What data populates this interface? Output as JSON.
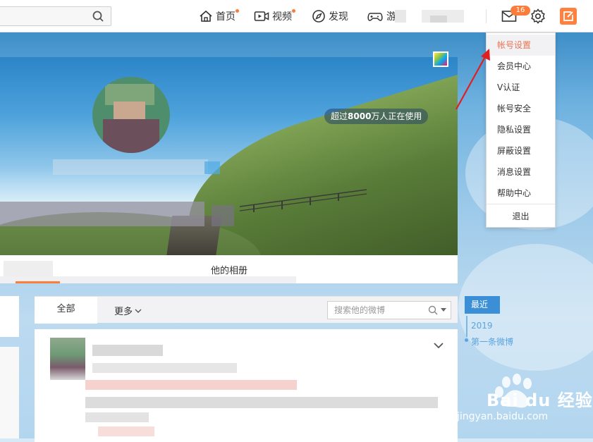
{
  "topbar": {
    "nav": [
      {
        "label": "首页",
        "icon": "home-icon"
      },
      {
        "label": "视频",
        "icon": "video-icon"
      },
      {
        "label": "发现",
        "icon": "compass-icon"
      },
      {
        "label": "游",
        "icon": "gamepad-icon"
      }
    ],
    "message_badge": "16"
  },
  "cover": {
    "users_pill_prefix": "超过",
    "users_pill_bold": "8000",
    "users_pill_suffix": "万人正在使用"
  },
  "profile_tabs": {
    "album_label": "他的相册"
  },
  "feed_nav": {
    "all_label": "全部",
    "more_label": "更多",
    "search_placeholder": "搜索他的微博"
  },
  "timeline": {
    "recent_label": "最近",
    "year": "2019",
    "first_post": "第一条微博"
  },
  "settings_menu": {
    "items": [
      "帐号设置",
      "会员中心",
      "V认证",
      "帐号安全",
      "隐私设置",
      "屏蔽设置",
      "消息设置",
      "帮助中心"
    ],
    "logout": "退出",
    "accent_color": "#eb7350"
  },
  "watermark": {
    "brand": "Bai du 经验",
    "url": "jingyan.baidu.com"
  },
  "colors": {
    "accent_orange": "#fa7d3c",
    "timeline_blue": "#3b8fd6",
    "arrow_red": "#e02020"
  }
}
